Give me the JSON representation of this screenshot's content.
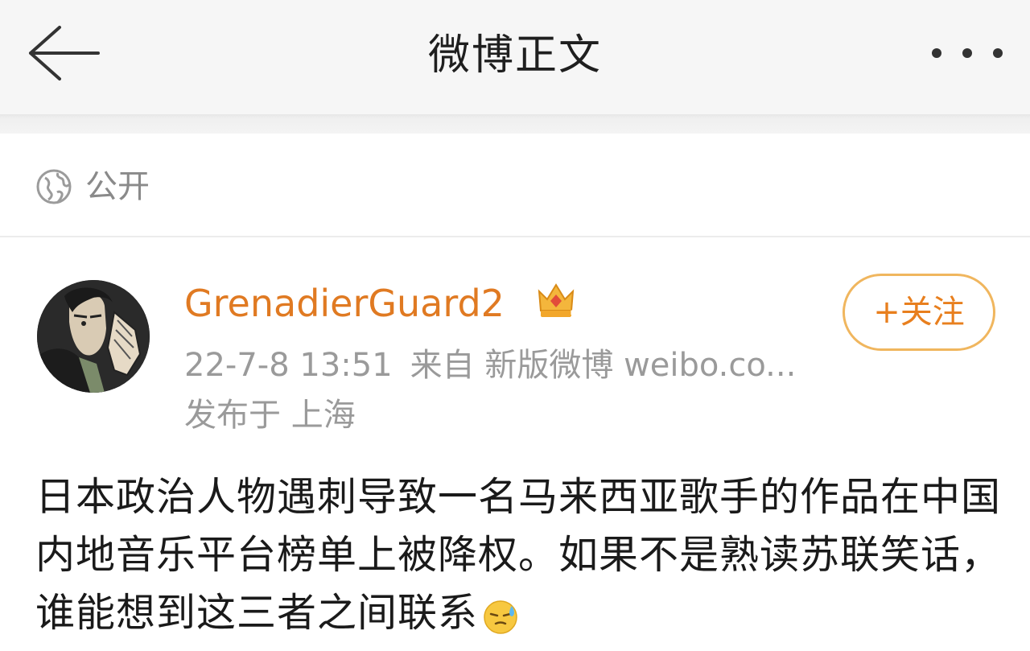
{
  "header": {
    "title": "微博正文",
    "back_icon": "back-arrow-icon",
    "more_icon": "more-dots-icon"
  },
  "visibility": {
    "icon": "globe-icon",
    "label": "公开"
  },
  "post": {
    "author": {
      "name": "GrenadierGuard2",
      "badge": "crown-level-5-icon",
      "badge_level": "5"
    },
    "follow_label": "+关注",
    "date": "22-7-8 13:51",
    "source": "来自 新版微博 weibo.co...",
    "location": "发布于 上海",
    "text": "日本政治人物遇刺导致一名马来西亚歌手的作品在中国内地音乐平台榜单上被降权。如果不是熟读苏联笑话，谁能想到这三者之间联系",
    "emoji": "sweat-emoji"
  },
  "colors": {
    "accent": "#e07a22",
    "follow_border": "#f0b65e",
    "meta_text": "#9a9a9a",
    "header_bg": "#f6f6f6"
  }
}
